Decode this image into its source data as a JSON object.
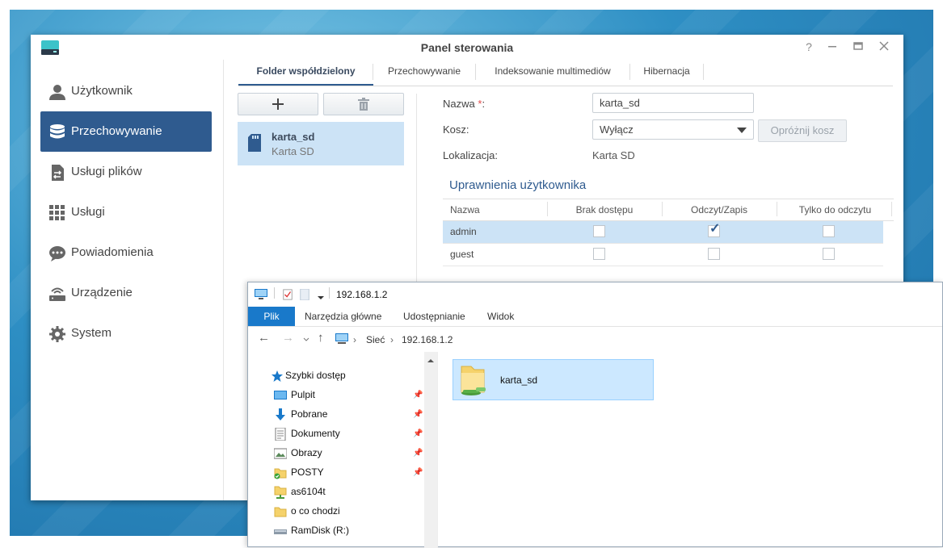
{
  "panel": {
    "title": "Panel sterowania",
    "help_icon": "?",
    "sidebar": [
      {
        "label": "Użytkownik",
        "icon": "user-icon"
      },
      {
        "label": "Przechowywanie",
        "icon": "database-icon",
        "active": true
      },
      {
        "label": "Usługi plików",
        "icon": "file-services-icon"
      },
      {
        "label": "Usługi",
        "icon": "grid-icon"
      },
      {
        "label": "Powiadomienia",
        "icon": "chat-bubble-icon"
      },
      {
        "label": "Urządzenie",
        "icon": "router-icon"
      },
      {
        "label": "System",
        "icon": "gear-icon"
      }
    ],
    "tabs": [
      "Folder współdzielony",
      "Przechowywanie",
      "Indeksowanie multimediów",
      "Hibernacja"
    ],
    "folder_list": [
      {
        "name": "karta_sd",
        "subtitle": "Karta SD"
      }
    ],
    "form": {
      "name_label": "Nazwa",
      "required_mark": "*",
      "name_colon": ":",
      "name_value": "karta_sd",
      "bin_label": "Kosz:",
      "bin_value": "Wyłącz",
      "empty_bin_button": "Opróżnij kosz",
      "location_label": "Lokalizacja:",
      "location_value": "Karta SD"
    },
    "permissions": {
      "title": "Uprawnienia użytkownika",
      "columns": [
        "Nazwa",
        "Brak dostępu",
        "Odczyt/Zapis",
        "Tylko do odczytu"
      ],
      "rows": [
        {
          "name": "admin",
          "no_access": false,
          "read_write": true,
          "read_only": false
        },
        {
          "name": "guest",
          "no_access": false,
          "read_write": false,
          "read_only": false
        }
      ]
    }
  },
  "explorer": {
    "title_path": "192.168.1.2",
    "ribbon_tabs": [
      "Plik",
      "Narzędzia główne",
      "Udostępnianie",
      "Widok"
    ],
    "breadcrumb": [
      "Sieć",
      "192.168.1.2"
    ],
    "tree": [
      {
        "label": "Szybki dostęp",
        "icon": "star-icon"
      },
      {
        "label": "Pulpit",
        "icon": "desktop-icon",
        "pinned": true
      },
      {
        "label": "Pobrane",
        "icon": "download-arrow-icon",
        "pinned": true
      },
      {
        "label": "Dokumenty",
        "icon": "document-icon",
        "pinned": true
      },
      {
        "label": "Obrazy",
        "icon": "picture-icon",
        "pinned": true
      },
      {
        "label": "POSTY",
        "icon": "synced-folder-icon",
        "pinned": true
      },
      {
        "label": "as6104t",
        "icon": "network-folder-icon"
      },
      {
        "label": "o co chodzi",
        "icon": "folder-icon"
      },
      {
        "label": "RamDisk (R:)",
        "icon": "drive-icon"
      }
    ],
    "items": [
      {
        "name": "karta_sd",
        "icon": "shared-folder-icon"
      }
    ]
  }
}
